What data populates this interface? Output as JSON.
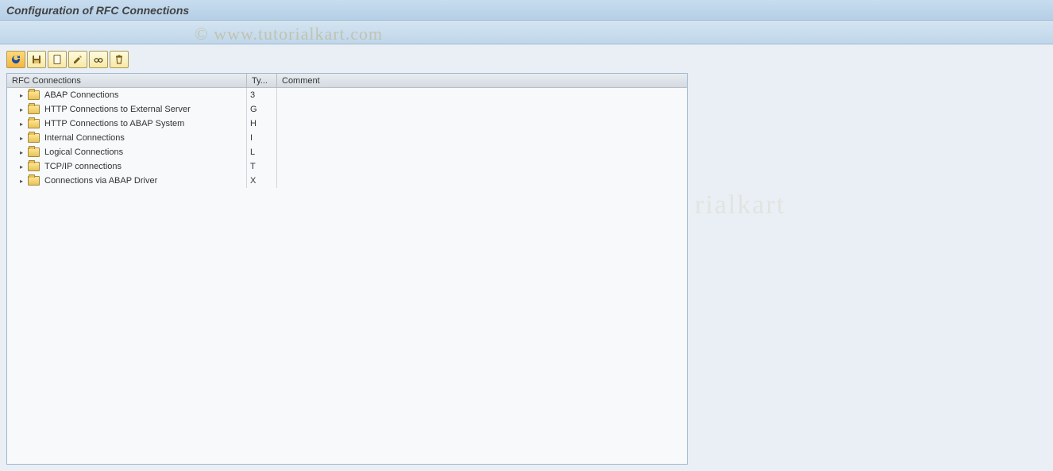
{
  "title": "Configuration of RFC Connections",
  "watermark": "© www.tutorialkart.com",
  "watermark2": "rialkart",
  "toolbar": {
    "refresh": "refresh",
    "save": "save",
    "create": "create",
    "edit": "edit",
    "find": "find",
    "delete": "delete"
  },
  "tree": {
    "headers": {
      "name": "RFC Connections",
      "type": "Ty...",
      "comment": "Comment"
    },
    "nodes": [
      {
        "label": "ABAP Connections",
        "type": "3",
        "comment": ""
      },
      {
        "label": "HTTP Connections to External Server",
        "type": "G",
        "comment": ""
      },
      {
        "label": "HTTP Connections to ABAP System",
        "type": "H",
        "comment": ""
      },
      {
        "label": "Internal Connections",
        "type": "I",
        "comment": ""
      },
      {
        "label": "Logical Connections",
        "type": "L",
        "comment": ""
      },
      {
        "label": "TCP/IP connections",
        "type": "T",
        "comment": ""
      },
      {
        "label": "Connections via ABAP Driver",
        "type": "X",
        "comment": ""
      }
    ]
  }
}
